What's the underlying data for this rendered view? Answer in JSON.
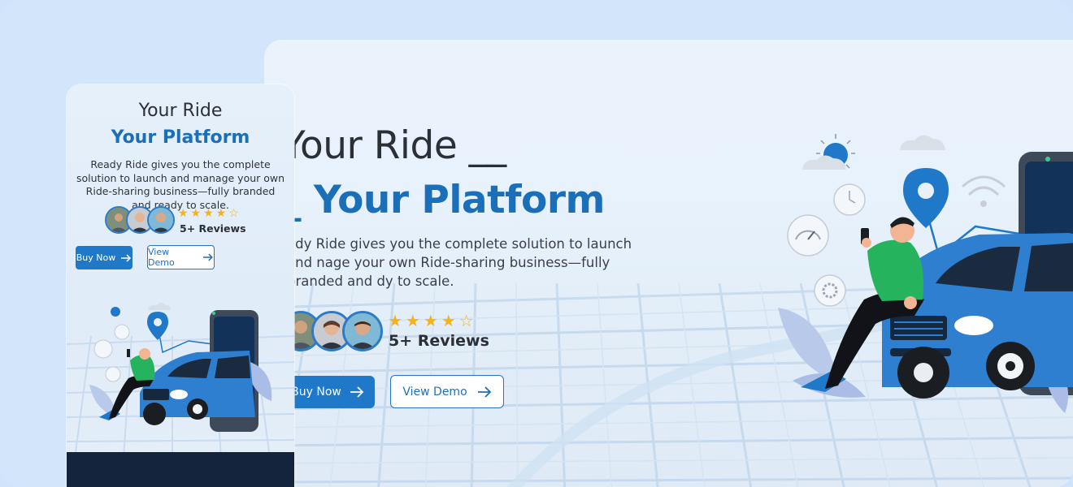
{
  "desktop": {
    "title_line1": "Your Ride __",
    "title_line2": "_ Your Platform",
    "description": "ady Ride gives you the complete solution to launch and nage your own Ride-sharing business—fully branded and dy to scale.",
    "rating_stars": "★★★★☆",
    "reviews": "5+ Reviews",
    "buy_label": "Buy Now",
    "demo_label": "View Demo"
  },
  "mobile": {
    "title_line1": "Your Ride",
    "title_line2": "Your Platform",
    "description": "Ready Ride gives you the complete solution to launch and manage your own Ride-sharing business—fully branded and ready to scale.",
    "rating_stars": "★★★★☆",
    "reviews": "5+ Reviews",
    "buy_label": "Buy Now",
    "demo_label": "View Demo"
  },
  "colors": {
    "brand_blue": "#1f78c8",
    "title_blue": "#1b6fb8",
    "star_yellow": "#f6b21a",
    "car_blue": "#2f7fd0"
  },
  "icons": [
    "arrow-right-icon",
    "location-pin-icon",
    "wifi-icon",
    "clock-icon",
    "speedometer-icon",
    "gear-icon",
    "sun-icon",
    "cloud-icon",
    "star-icon"
  ]
}
